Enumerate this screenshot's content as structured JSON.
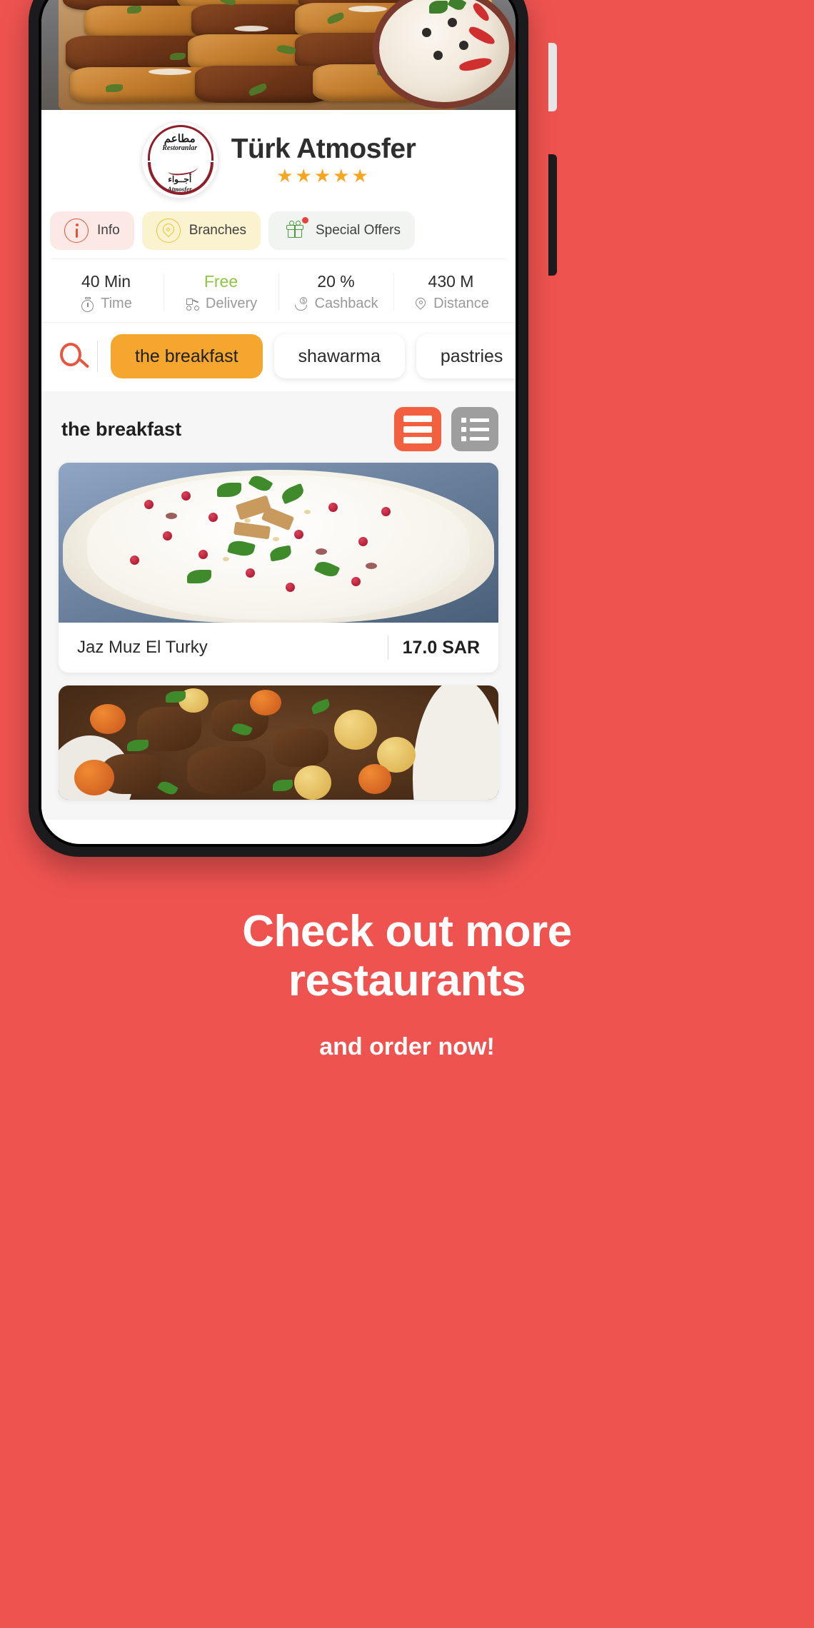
{
  "theme": {
    "background": "#EF5350",
    "accent_orange": "#F5A62E",
    "accent_red": "#F2603F",
    "green": "#8dc63f"
  },
  "restaurant": {
    "name": "Türk Atmosfer",
    "rating_stars": "★★★★★",
    "logo": {
      "arabic_top": "مطاعم",
      "latin_top": "Restoranlar",
      "arabic_bottom": "أجــواء",
      "latin_bottom": "Atmosfer"
    }
  },
  "actions": [
    {
      "label": "Info",
      "icon": "info-circle-icon",
      "badge": false
    },
    {
      "label": "Branches",
      "icon": "location-pin-icon",
      "badge": false
    },
    {
      "label": "Special Offers",
      "icon": "gift-icon",
      "badge": true
    }
  ],
  "stats": [
    {
      "value": "40 Min",
      "label": "Time",
      "icon": "timer-icon"
    },
    {
      "value": "Free",
      "label": "Delivery",
      "icon": "scooter-icon"
    },
    {
      "value": "20 %",
      "label": "Cashback",
      "icon": "cashback-icon"
    },
    {
      "value": "430 M",
      "label": "Distance",
      "icon": "location-icon"
    }
  ],
  "search": {
    "icon": "search-icon"
  },
  "categories": [
    {
      "label": "the breakfast",
      "active": true
    },
    {
      "label": "shawarma",
      "active": false
    },
    {
      "label": "pastries",
      "active": false
    }
  ],
  "menu": {
    "section_title": "the breakfast",
    "view_toggles": [
      {
        "icon": "card-view-icon",
        "active": true
      },
      {
        "icon": "list-view-icon",
        "active": false
      }
    ],
    "items": [
      {
        "name": "Jaz Muz El Turky",
        "price": "17.0 SAR",
        "image": "fatteh-with-yogurt-and-pomegranate"
      },
      {
        "name": "",
        "price": "",
        "image": "beef-stew-with-potatoes-and-carrots"
      }
    ]
  },
  "promo": {
    "headline_line1": "Check out more",
    "headline_line2": "restaurants",
    "subtitle": "and order now!"
  }
}
